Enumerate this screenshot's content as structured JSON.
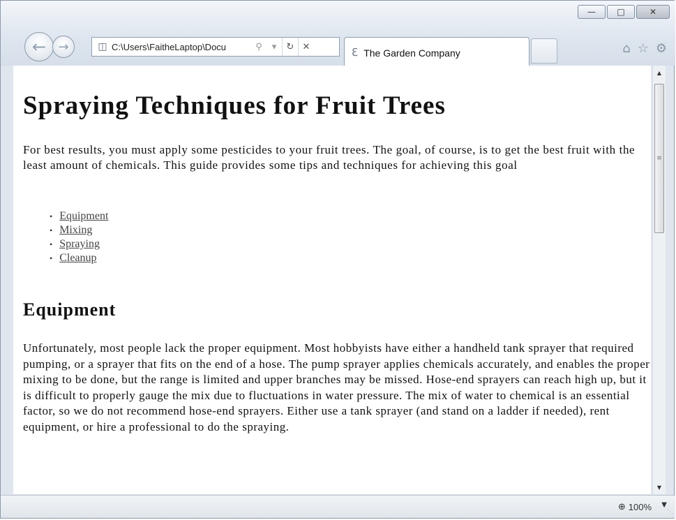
{
  "browser": {
    "address_url": "C:\\Users\\FaitheLaptop\\Docu",
    "tab_title": "The Garden Company",
    "zoom": "100%"
  },
  "page": {
    "title": "Spraying Techniques for Fruit Trees",
    "intro": "For best results, you must apply some pesticides to your fruit trees. The goal, of course, is to get the best fruit with the least amount of chemicals. This guide provides some tips and techniques for achieving this goal",
    "links": [
      {
        "label": "Equipment"
      },
      {
        "label": "Mixing"
      },
      {
        "label": "Spraying"
      },
      {
        "label": "Cleanup"
      }
    ],
    "section_heading": "Equipment",
    "section_text": "Unfortunately, most people lack the proper equipment. Most hobbyists have either a handheld tank sprayer that required pumping, or a sprayer that fits on the end of a hose. The pump sprayer applies chemicals accurately, and enables the proper mixing to be done, but the range is limited and upper branches may be missed. Hose-end sprayers can reach high up, but it is difficult to properly gauge the mix due to fluctuations in water pressure. The mix of water to chemical is an essential factor, so we do not recommend hose-end sprayers. Either use a tank sprayer (and stand on a ladder if needed), rent equipment, or hire a professional to do the spraying."
  }
}
